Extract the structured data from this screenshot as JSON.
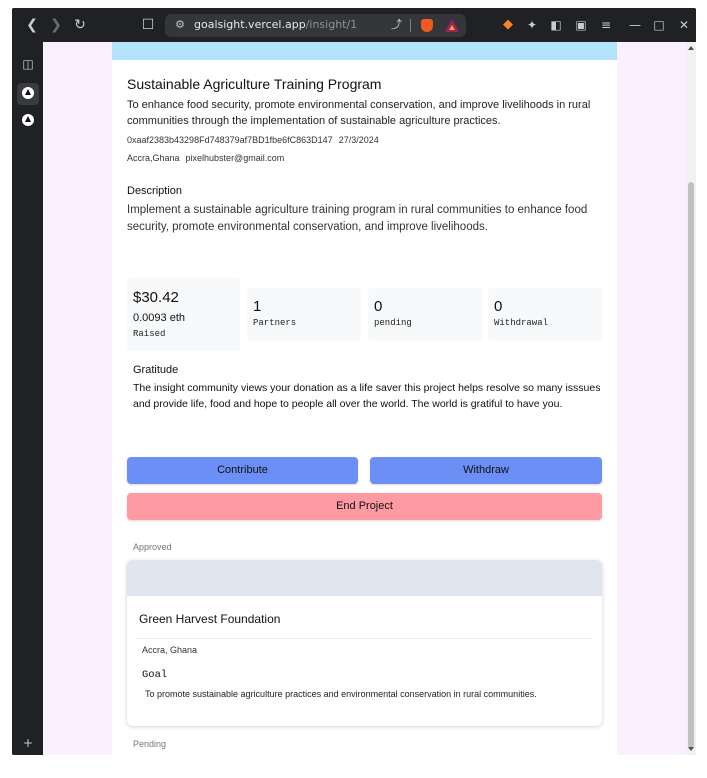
{
  "browser": {
    "url_host": "goalsight.vercel.app",
    "url_path": "/insight/1"
  },
  "project": {
    "title": "Sustainable Agriculture Training Program",
    "subtitle": "To enhance food security, promote environmental conservation, and improve livelihoods in rural communities through the implementation of sustainable agriculture practices.",
    "address": "0xaaf2383b43298Fd748379af7BD1fbe6fC863D147",
    "date": "27/3/2024",
    "location": "Accra,Ghana",
    "email": "pixelhubster@gmail.com",
    "description_heading": "Description",
    "description": "Implement a sustainable agriculture training program in rural communities to enhance food security, promote environmental conservation, and improve livelihoods."
  },
  "stats": {
    "raised_usd": "$30.42",
    "raised_eth": "0.0093 eth",
    "raised_label": "Raised",
    "partners_value": "1",
    "partners_label": "Partners",
    "pending_value": "0",
    "pending_label": "pending",
    "withdrawal_value": "0",
    "withdrawal_label": "Withdrawal"
  },
  "gratitude": {
    "heading": "Gratitude",
    "text": "The insight community views your donation as a life saver this project helps resolve so many isssues and provide life, food and hope to people all over the world. The world is gratiful to have you."
  },
  "actions": {
    "contribute": "Contribute",
    "withdraw": "Withdraw",
    "end_project": "End Project"
  },
  "approved": {
    "label": "Approved",
    "org_name": "Green Harvest Foundation",
    "location": "Accra, Ghana",
    "goal_heading": "Goal",
    "goal": "To promote sustainable agriculture practices and environmental conservation in rural communities."
  },
  "pending": {
    "label": "Pending"
  },
  "colors": {
    "banner": "#b3e3fb",
    "primary_button": "#6c8ff6",
    "danger_button": "#fe9ba2",
    "page_background": "#fbf0fd"
  }
}
